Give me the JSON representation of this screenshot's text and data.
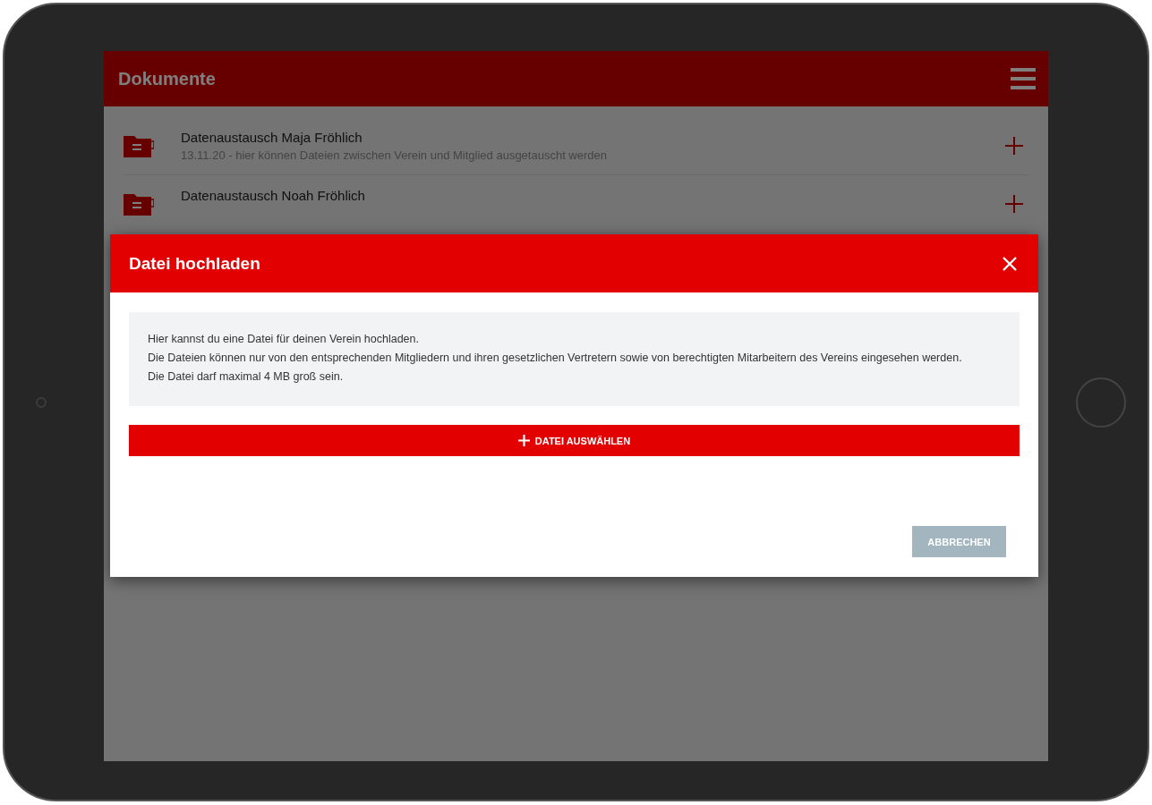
{
  "app_bar": {
    "title": "Dokumente"
  },
  "documents": [
    {
      "title": "Datenaustausch Maja Fröhlich",
      "subtitle": "13.11.20 - hier können Dateien zwischen Verein und Mitglied ausgetauscht werden"
    },
    {
      "title": "Datenaustausch Noah Fröhlich"
    }
  ],
  "dialog": {
    "title": "Datei hochladen",
    "info_lines": [
      "Hier kannst du eine Datei für deinen Verein hochladen.",
      "Die Dateien können nur von den entsprechenden Mitgliedern und ihren gesetzlichen Vertretern sowie von berechtigten Mitarbeitern des Vereins eingesehen werden.",
      "Die Datei darf maximal 4 MB groß sein."
    ],
    "select_button": "DATEI AUSWÄHLEN",
    "cancel_button": "ABBRECHEN"
  }
}
